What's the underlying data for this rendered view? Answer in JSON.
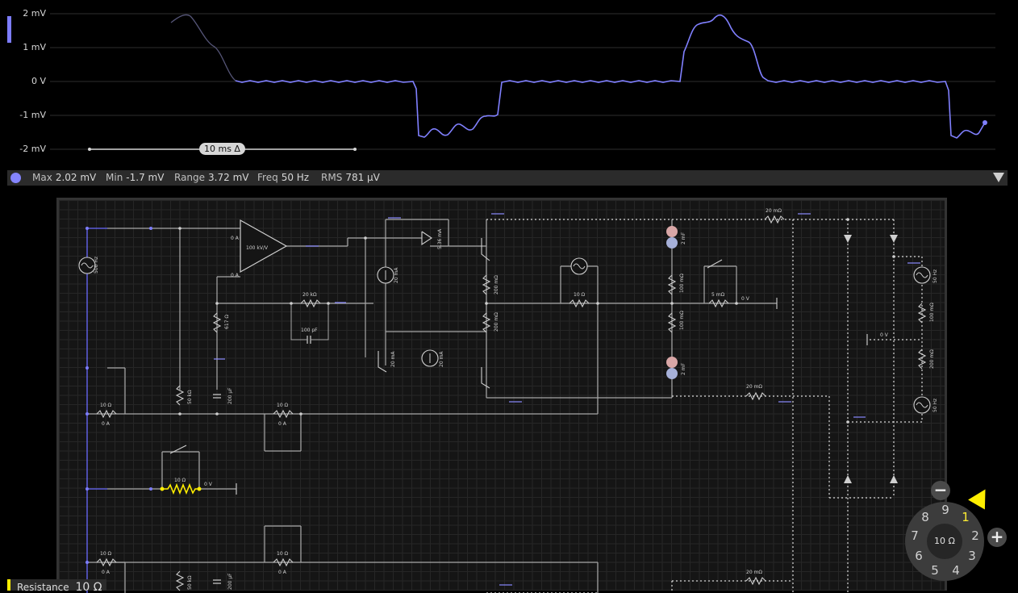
{
  "scope": {
    "y_labels": [
      "2 mV",
      "1 mV",
      "0 V",
      "-1 mV",
      "-2 mV"
    ],
    "time_delta": "10 ms Δ",
    "trace_color": "#8080ff"
  },
  "stats": {
    "max_label": "Max",
    "max_value": "2.02 mV",
    "min_label": "Min",
    "min_value": "-1.7 mV",
    "range_label": "Range",
    "range_value": "3.72 mV",
    "freq_label": "Freq",
    "freq_value": "50 Hz",
    "rms_label": "RMS",
    "rms_value": "781 μV"
  },
  "circuit": {
    "source_1": "500 Hz",
    "opamp_gain": "100 kV/V",
    "opamp_in_plus": "0 A",
    "opamp_in_minus": "0 A",
    "r_feedback": "20 kΩ",
    "c_feedback": "100 pF",
    "r_617": "617 Ω",
    "r_50k_1": "50 kΩ",
    "c_200u_1": "200 μF",
    "i_src_1": "20 mA",
    "i_src_2": "20 mA",
    "i_src_3": "20 mA",
    "i_bjt": "5.36 mA",
    "r_200m_1": "200 mΩ",
    "r_200m_2": "200 mΩ",
    "r_10_mid": "10 Ω",
    "r_100m_1": "100 mΩ",
    "r_100m_2": "100 mΩ",
    "c_2m_1": "2 mF",
    "c_2m_2": "2 mF",
    "r_5m": "5 mΩ",
    "v_0_1": "0 V",
    "r_20m_top": "20 mΩ",
    "r_20m_mid": "20 mΩ",
    "r_20m_bot": "20 mΩ",
    "src_50_1": "50 Hz",
    "src_50_2": "50 Hz",
    "r_100m_right": "100 mΩ",
    "r_200m_right": "200 mΩ",
    "v_0_right": "0 V",
    "r_10_a": "10 Ω",
    "i_0a_a": "0 A",
    "r_10_b": "10 Ω",
    "i_0a_b": "0 A",
    "r_10_sel": "10 Ω",
    "v_0_sel": "0 V",
    "r_10_c": "10 Ω",
    "i_0a_c": "0 A",
    "r_10_d": "10 Ω",
    "i_0a_d": "0 A",
    "r_50k_2": "50 kΩ",
    "c_200u_2": "200 μF"
  },
  "dial": {
    "center": "10 Ω",
    "numbers": [
      "1",
      "2",
      "3",
      "4",
      "5",
      "6",
      "7",
      "8",
      "9"
    ],
    "selected": "1",
    "minus": "−",
    "plus": "+"
  },
  "resistance": {
    "label": "Resistance",
    "value": "10 Ω"
  }
}
